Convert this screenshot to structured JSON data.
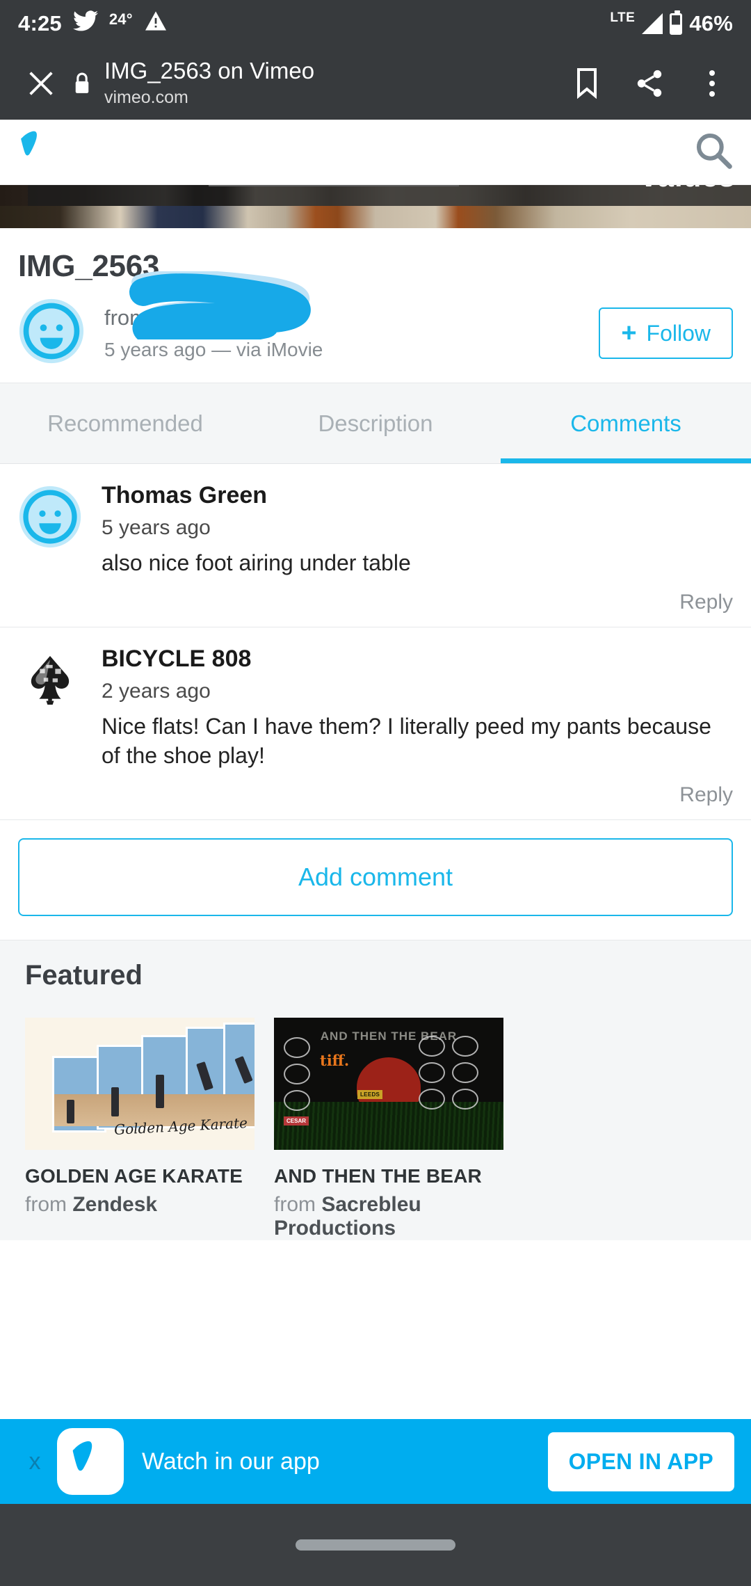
{
  "status_bar": {
    "time": "4:25",
    "twitter_icon": "twitter-icon",
    "temperature": "24°",
    "warning_icon": "warning-triangle-icon",
    "network": "LTE",
    "signal_icon": "signal-icon",
    "battery_icon": "battery-icon",
    "battery_percent": "46%"
  },
  "browser_tab": {
    "close_icon": "close-icon",
    "lock_icon": "lock-icon",
    "title": "IMG_2563 on Vimeo",
    "url": "vimeo.com",
    "bookmark_icon": "bookmark-icon",
    "share_icon": "share-icon",
    "overflow_icon": "more-vertical-icon"
  },
  "site_nav": {
    "logo": "vimeo-logo",
    "search_icon": "search-icon"
  },
  "player": {
    "overlay_text": "values",
    "scrubber": "progress-bar"
  },
  "video": {
    "title": "IMG_2563",
    "avatar": "smiley-avatar",
    "from_label": "from",
    "uploader": "",
    "uploader_redacted": "blue-scribble-redaction",
    "meta": "5 years ago — via iMovie",
    "follow_label": "Follow",
    "follow_plus": "+"
  },
  "tabs": [
    {
      "label": "Recommended",
      "active": false
    },
    {
      "label": "Description",
      "active": false
    },
    {
      "label": "Comments",
      "active": true
    }
  ],
  "comments": [
    {
      "avatar": "smiley-avatar",
      "name": "Thomas Green",
      "time": "5 years ago",
      "text": "also nice foot airing under table",
      "reply_label": "Reply"
    },
    {
      "avatar": "spade-card-avatar",
      "name": "BICYCLE 808",
      "time": "2 years ago",
      "text": "Nice flats! Can I have them? I literally peed my pants because of the shoe play!",
      "reply_label": "Reply"
    }
  ],
  "add_comment": {
    "label": "Add comment"
  },
  "featured": {
    "heading": "Featured",
    "items": [
      {
        "thumbnail": "golden-age-karate-thumbnail",
        "thumb_caption": "Golden Age Karate",
        "title": "GOLDEN AGE KARATE",
        "from_label": "from",
        "author": "Zendesk"
      },
      {
        "thumbnail": "and-then-the-bear-thumbnail",
        "thumb_caption": "AND THEN THE BEAR",
        "thumb_badge": "tiff.",
        "thumb_festival_1": "LEEDS",
        "thumb_festival_2": "CESAR",
        "title": "AND THEN THE BEAR",
        "from_label": "from",
        "author": "Sacrebleu Productions"
      }
    ]
  },
  "app_banner": {
    "close_label": "x",
    "logo": "vimeo-app-icon",
    "text": "Watch in our app",
    "button_label": "OPEN IN APP"
  },
  "nav_bar": {
    "home_pill": "home-gesture-pill"
  },
  "colors": {
    "vimeo_blue": "#1ab7ea",
    "banner_blue": "#00adef",
    "chrome_dark": "#373a3d",
    "page_grey": "#f4f6f7"
  }
}
